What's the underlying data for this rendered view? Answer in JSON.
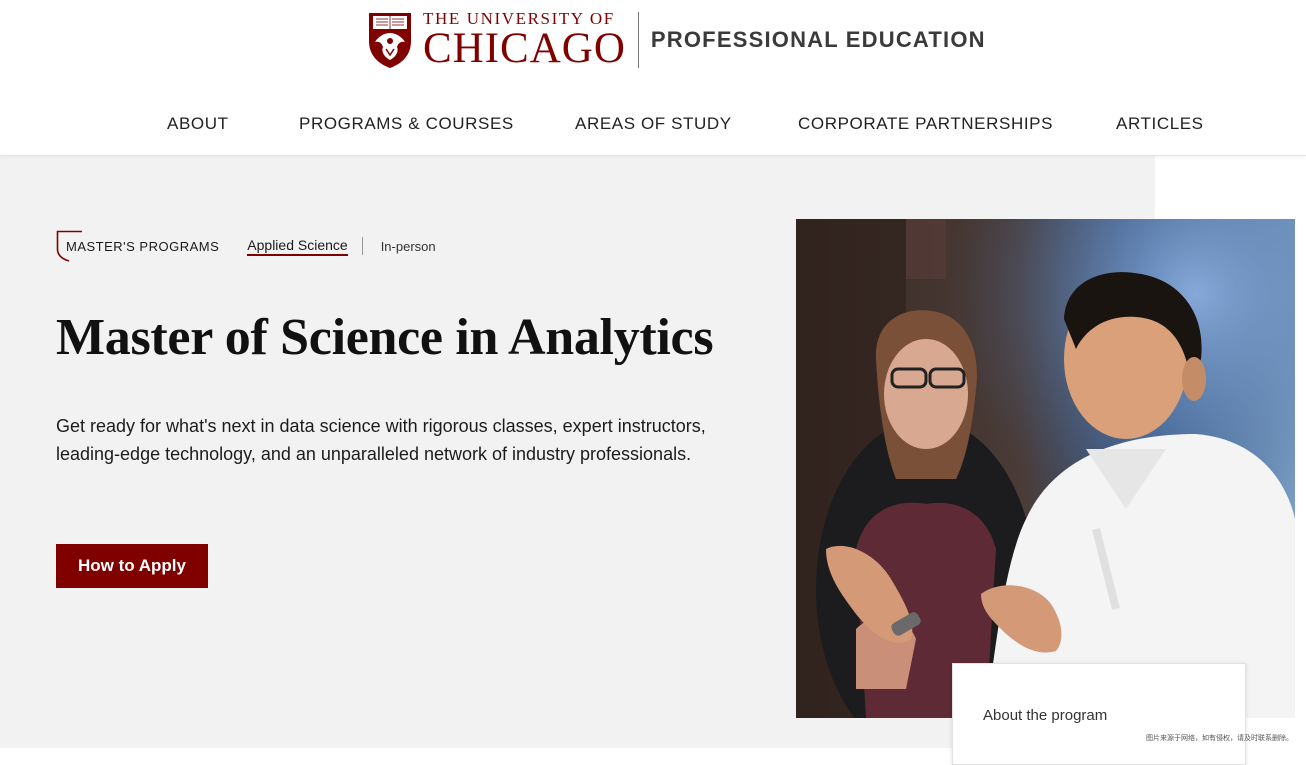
{
  "logo": {
    "line1": "THE UNIVERSITY OF",
    "line2": "CHICAGO",
    "division": "PROFESSIONAL EDUCATION",
    "crest_icon": "phoenix-crest-icon",
    "brand_color": "#800000"
  },
  "nav": {
    "items": [
      {
        "label": "ABOUT"
      },
      {
        "label": "PROGRAMS & COURSES"
      },
      {
        "label": "AREAS OF STUDY"
      },
      {
        "label": "CORPORATE PARTNERSHIPS"
      },
      {
        "label": "ARTICLES"
      }
    ]
  },
  "breadcrumb": {
    "program_type": "MASTER'S PROGRAMS",
    "area": "Applied Science",
    "format": "In-person"
  },
  "hero": {
    "title": "Master of Science in Analytics",
    "description": "Get ready for what's next in data science with rigorous classes, expert instructors, leading-edge technology, and an unparalleled network of industry professionals.",
    "cta_label": "How to Apply"
  },
  "about_card": {
    "label": "About the program"
  },
  "watermark": {
    "text": "图片来源于网络，如有侵权，请及时联系删除。"
  },
  "colors": {
    "accent": "#800000",
    "hero_bg": "#f2f2f2"
  }
}
